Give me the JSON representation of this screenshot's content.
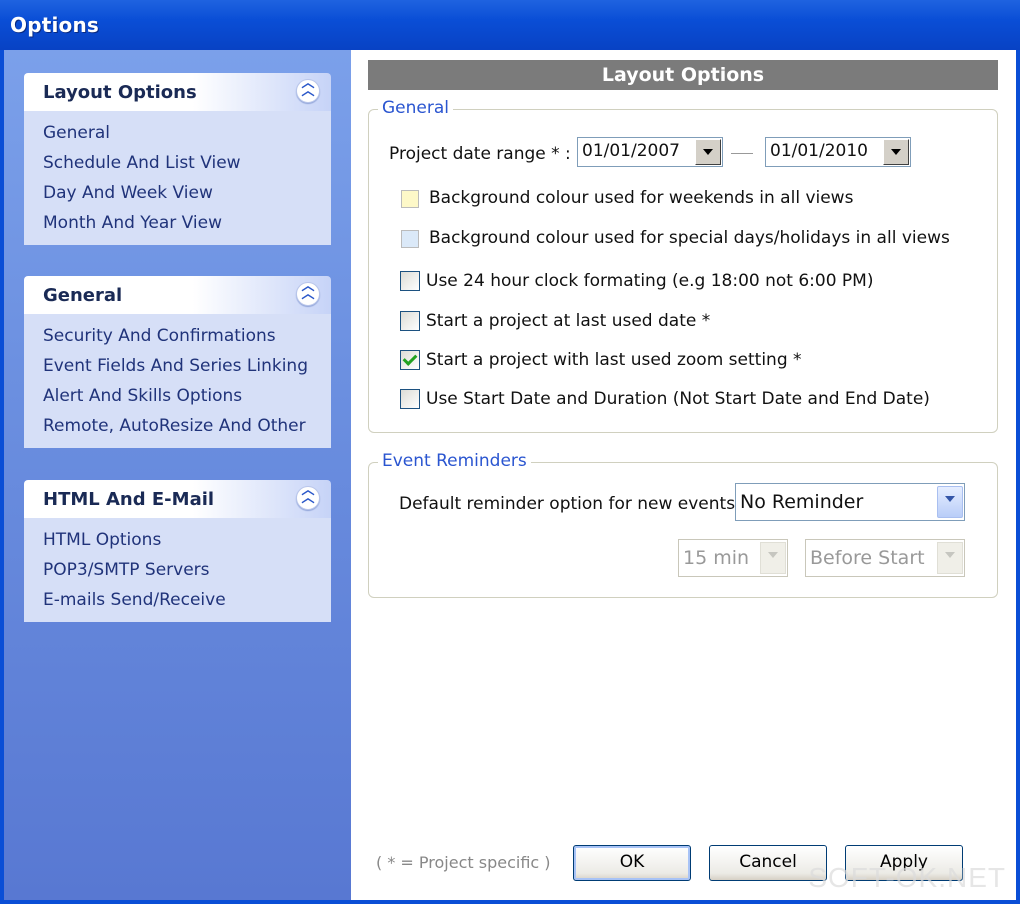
{
  "window": {
    "title": "Options"
  },
  "sidebar": {
    "groups": [
      {
        "title": "Layout Options",
        "items": [
          "General",
          "Schedule And List View",
          "Day And Week View",
          "Month And Year View"
        ]
      },
      {
        "title": "General",
        "items": [
          "Security And Confirmations",
          "Event Fields And Series Linking",
          "Alert And Skills Options",
          "Remote, AutoResize And Other"
        ]
      },
      {
        "title": "HTML And E-Mail",
        "items": [
          "HTML Options",
          "POP3/SMTP Servers",
          "E-mails Send/Receive"
        ]
      }
    ]
  },
  "main": {
    "header": "Layout Options",
    "general": {
      "legend": "General",
      "date_range_label": "Project date range * :",
      "date_from": "01/01/2007",
      "date_to": "01/01/2010",
      "options": [
        {
          "label": "Background colour used for weekends in all views",
          "type": "swatch",
          "color": "#fdf8c8"
        },
        {
          "label": "Background colour used for special days/holidays in all views",
          "type": "swatch",
          "color": "#dbe9f8"
        },
        {
          "label": "Use 24 hour clock formating (e.g 18:00 not 6:00 PM)",
          "type": "checkbox",
          "checked": false
        },
        {
          "label": "Start a project at last used date *",
          "type": "checkbox",
          "checked": false
        },
        {
          "label": "Start a project with last used zoom setting *",
          "type": "checkbox",
          "checked": true
        },
        {
          "label": "Use Start Date and Duration (Not Start Date and End Date)",
          "type": "checkbox",
          "checked": false
        }
      ]
    },
    "reminders": {
      "legend": "Event Reminders",
      "default_label": "Default reminder option for new events :",
      "default_value": "No Reminder",
      "interval_value": "15 min",
      "relative_value": "Before Start"
    },
    "footer": {
      "note": "( * = Project specific )",
      "ok": "OK",
      "cancel": "Cancel",
      "apply": "Apply"
    },
    "watermark": "SOFT-OK.NET"
  }
}
